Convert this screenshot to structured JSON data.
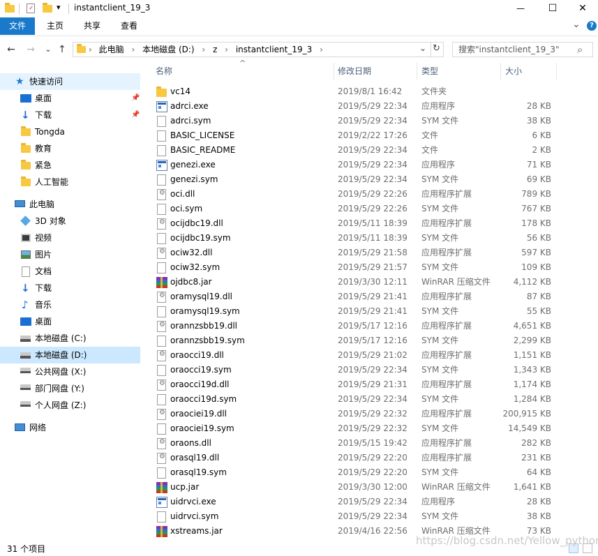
{
  "window": {
    "title": "instantclient_19_3",
    "quick_access_toolbar_arrow": "▾",
    "minimize": "—",
    "maximize": "☐",
    "close": "✕"
  },
  "ribbon": {
    "tabs": [
      "文件",
      "主页",
      "共享",
      "查看"
    ],
    "expand": "⌄",
    "help": "?"
  },
  "nav": {
    "back": "←",
    "forward": "→",
    "recent": "⌄",
    "up": "↑",
    "breadcrumbs": [
      "此电脑",
      "本地磁盘 (D:)",
      "z",
      "instantclient_19_3"
    ],
    "breadcrumb_separator": "›",
    "dropdown": "⌄",
    "refresh": "↻",
    "search_placeholder": "搜索\"instantclient_19_3\"",
    "search_icon": "⌕"
  },
  "navpane": {
    "quick_access": "快速访问",
    "quick_items": [
      "桌面",
      "下载",
      "Tongda",
      "教育",
      "紧急",
      "人工智能"
    ],
    "this_pc": "此电脑",
    "pc_items": [
      "3D 对象",
      "视频",
      "图片",
      "文档",
      "下载",
      "音乐",
      "桌面",
      "本地磁盘 (C:)",
      "本地磁盘 (D:)",
      "公共网盘 (X:)",
      "部门网盘 (Y:)",
      "个人网盘 (Z:)"
    ],
    "network": "网络",
    "pin": "📌"
  },
  "columns": {
    "name": "名称",
    "date": "修改日期",
    "type": "类型",
    "size": "大小",
    "sort_arrow": "^"
  },
  "files": [
    {
      "name": "vc14",
      "date": "2019/8/1 16:42",
      "type": "文件夹",
      "size": "",
      "icon": "folder"
    },
    {
      "name": "adrci.exe",
      "date": "2019/5/29 22:34",
      "type": "应用程序",
      "size": "28 KB",
      "icon": "exe"
    },
    {
      "name": "adrci.sym",
      "date": "2019/5/29 22:34",
      "type": "SYM 文件",
      "size": "38 KB",
      "icon": "doc"
    },
    {
      "name": "BASIC_LICENSE",
      "date": "2019/2/22 17:26",
      "type": "文件",
      "size": "6 KB",
      "icon": "doc"
    },
    {
      "name": "BASIC_README",
      "date": "2019/5/29 22:34",
      "type": "文件",
      "size": "2 KB",
      "icon": "doc"
    },
    {
      "name": "genezi.exe",
      "date": "2019/5/29 22:34",
      "type": "应用程序",
      "size": "71 KB",
      "icon": "exe"
    },
    {
      "name": "genezi.sym",
      "date": "2019/5/29 22:34",
      "type": "SYM 文件",
      "size": "69 KB",
      "icon": "doc"
    },
    {
      "name": "oci.dll",
      "date": "2019/5/29 22:26",
      "type": "应用程序扩展",
      "size": "789 KB",
      "icon": "dll"
    },
    {
      "name": "oci.sym",
      "date": "2019/5/29 22:26",
      "type": "SYM 文件",
      "size": "767 KB",
      "icon": "doc"
    },
    {
      "name": "ocijdbc19.dll",
      "date": "2019/5/11 18:39",
      "type": "应用程序扩展",
      "size": "178 KB",
      "icon": "dll"
    },
    {
      "name": "ocijdbc19.sym",
      "date": "2019/5/11 18:39",
      "type": "SYM 文件",
      "size": "56 KB",
      "icon": "doc"
    },
    {
      "name": "ociw32.dll",
      "date": "2019/5/29 21:58",
      "type": "应用程序扩展",
      "size": "597 KB",
      "icon": "dll"
    },
    {
      "name": "ociw32.sym",
      "date": "2019/5/29 21:57",
      "type": "SYM 文件",
      "size": "109 KB",
      "icon": "doc"
    },
    {
      "name": "ojdbc8.jar",
      "date": "2019/3/30 12:11",
      "type": "WinRAR 压缩文件",
      "size": "4,112 KB",
      "icon": "rar"
    },
    {
      "name": "oramysql19.dll",
      "date": "2019/5/29 21:41",
      "type": "应用程序扩展",
      "size": "87 KB",
      "icon": "dll"
    },
    {
      "name": "oramysql19.sym",
      "date": "2019/5/29 21:41",
      "type": "SYM 文件",
      "size": "55 KB",
      "icon": "doc"
    },
    {
      "name": "orannzsbb19.dll",
      "date": "2019/5/17 12:16",
      "type": "应用程序扩展",
      "size": "4,651 KB",
      "icon": "dll"
    },
    {
      "name": "orannzsbb19.sym",
      "date": "2019/5/17 12:16",
      "type": "SYM 文件",
      "size": "2,299 KB",
      "icon": "doc"
    },
    {
      "name": "oraocci19.dll",
      "date": "2019/5/29 21:02",
      "type": "应用程序扩展",
      "size": "1,151 KB",
      "icon": "dll"
    },
    {
      "name": "oraocci19.sym",
      "date": "2019/5/29 22:34",
      "type": "SYM 文件",
      "size": "1,343 KB",
      "icon": "doc"
    },
    {
      "name": "oraocci19d.dll",
      "date": "2019/5/29 21:31",
      "type": "应用程序扩展",
      "size": "1,174 KB",
      "icon": "dll"
    },
    {
      "name": "oraocci19d.sym",
      "date": "2019/5/29 22:34",
      "type": "SYM 文件",
      "size": "1,284 KB",
      "icon": "doc"
    },
    {
      "name": "oraociei19.dll",
      "date": "2019/5/29 22:32",
      "type": "应用程序扩展",
      "size": "200,915 KB",
      "icon": "dll"
    },
    {
      "name": "oraociei19.sym",
      "date": "2019/5/29 22:32",
      "type": "SYM 文件",
      "size": "14,549 KB",
      "icon": "doc"
    },
    {
      "name": "oraons.dll",
      "date": "2019/5/15 19:42",
      "type": "应用程序扩展",
      "size": "282 KB",
      "icon": "dll"
    },
    {
      "name": "orasql19.dll",
      "date": "2019/5/29 22:20",
      "type": "应用程序扩展",
      "size": "231 KB",
      "icon": "dll"
    },
    {
      "name": "orasql19.sym",
      "date": "2019/5/29 22:20",
      "type": "SYM 文件",
      "size": "64 KB",
      "icon": "doc"
    },
    {
      "name": "ucp.jar",
      "date": "2019/3/30 12:00",
      "type": "WinRAR 压缩文件",
      "size": "1,641 KB",
      "icon": "rar"
    },
    {
      "name": "uidrvci.exe",
      "date": "2019/5/29 22:34",
      "type": "应用程序",
      "size": "28 KB",
      "icon": "exe"
    },
    {
      "name": "uidrvci.sym",
      "date": "2019/5/29 22:34",
      "type": "SYM 文件",
      "size": "38 KB",
      "icon": "doc"
    },
    {
      "name": "xstreams.jar",
      "date": "2019/4/16 22:56",
      "type": "WinRAR 压缩文件",
      "size": "73 KB",
      "icon": "rar"
    }
  ],
  "status": {
    "count": "31 个项目"
  },
  "watermark": "https://blog.csdn.net/Yellow_python",
  "colors": {
    "accent": "#1979ca",
    "selected_bg": "#cce8ff",
    "header_text": "#4c607a"
  }
}
